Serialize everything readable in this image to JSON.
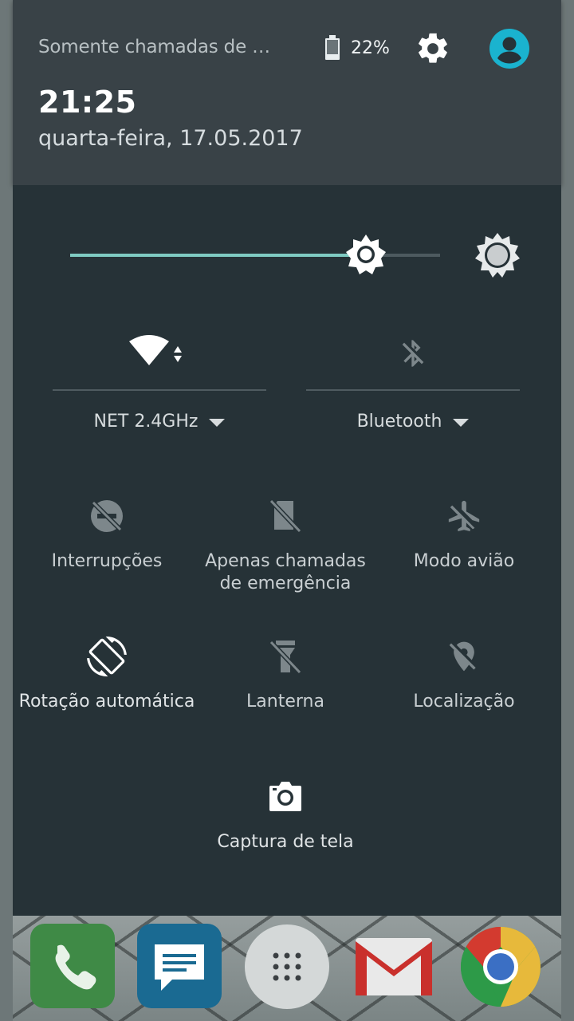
{
  "header": {
    "status_text": "Somente chamadas de e…",
    "battery_percent": "22%",
    "battery_level": 0.22,
    "clock": "21:25",
    "date": "quarta-feira, 17.05.2017",
    "icons": {
      "settings": "gear-icon",
      "user": "account-circle-icon"
    },
    "accent_color": "#1ab3cf"
  },
  "brightness": {
    "level": 0.8,
    "accent_color": "#7fcbc2"
  },
  "big_tiles": [
    {
      "label": "NET 2.4GHz",
      "icon": "wifi-icon",
      "active": true
    },
    {
      "label": "Bluetooth",
      "icon": "bluetooth-disabled-icon",
      "active": false
    }
  ],
  "tiles": [
    {
      "label": "Interrupções",
      "icon": "do-not-disturb-off-icon",
      "active": false
    },
    {
      "label": "Apenas chamadas de emergência",
      "icon": "sim-off-icon",
      "active": false
    },
    {
      "label": "Modo avião",
      "icon": "airplane-off-icon",
      "active": false
    },
    {
      "label": "Rotação automática",
      "icon": "screen-rotation-icon",
      "active": true
    },
    {
      "label": "Lanterna",
      "icon": "flashlight-off-icon",
      "active": false
    },
    {
      "label": "Localização",
      "icon": "location-off-icon",
      "active": false
    },
    {
      "label": "Captura de tela",
      "icon": "camera-icon",
      "active": true
    }
  ],
  "dock": [
    {
      "name": "phone",
      "icon": "phone-icon"
    },
    {
      "name": "messages",
      "icon": "message-icon"
    },
    {
      "name": "app-drawer",
      "icon": "app-drawer-icon"
    },
    {
      "name": "gmail",
      "icon": "gmail-icon"
    },
    {
      "name": "chrome",
      "icon": "chrome-icon"
    }
  ]
}
